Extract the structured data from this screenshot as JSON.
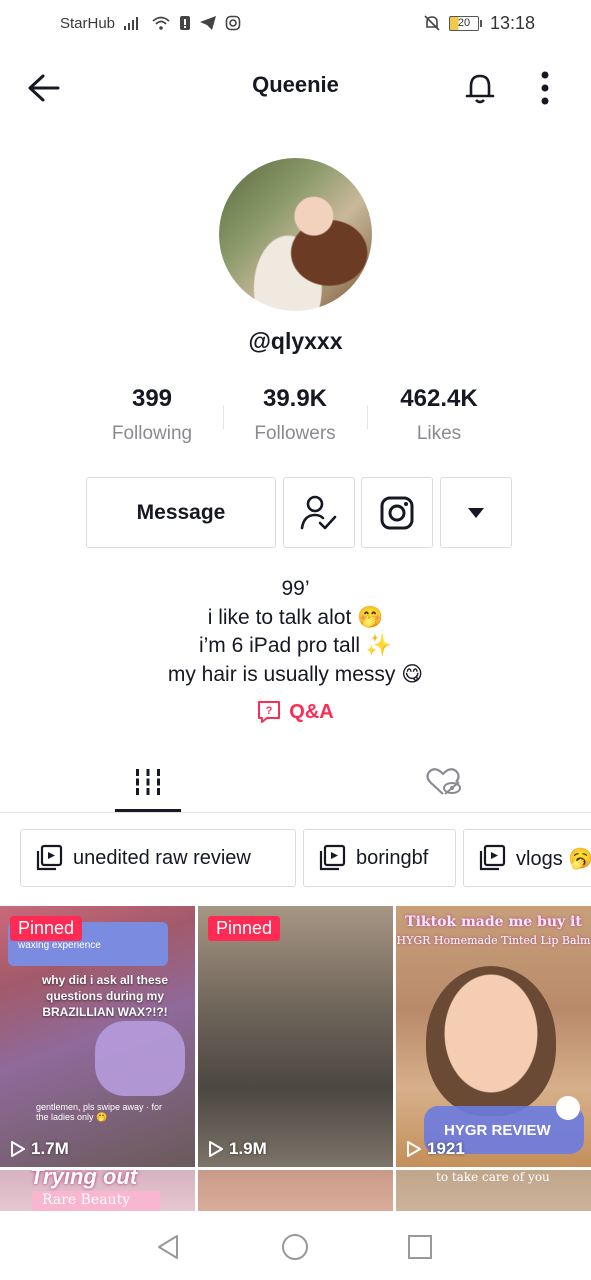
{
  "status_bar": {
    "carrier": "StarHub",
    "battery": "20",
    "time": "13:18"
  },
  "header": {
    "title": "Queenie"
  },
  "profile": {
    "username": "@qlyxxx",
    "stats": [
      {
        "value": "399",
        "label": "Following"
      },
      {
        "value": "39.9K",
        "label": "Followers"
      },
      {
        "value": "462.4K",
        "label": "Likes"
      }
    ],
    "message_label": "Message",
    "bio": [
      "99’",
      "i like to talk alot 🤭",
      "i’m 6 iPad pro tall ✨",
      "my hair is usually messy 😋"
    ],
    "qa_label": "Q&A"
  },
  "playlists": [
    {
      "label": "unedited raw review"
    },
    {
      "label": "boringbf"
    },
    {
      "label": "vlogs 🥱"
    }
  ],
  "videos": [
    {
      "pinned_label": "Pinned",
      "views": "1.7M",
      "card_text": "waxing experience",
      "caption": "why did i ask all these questions during my BRAZILLIAN WAX?!?!",
      "footer": "gentlemen, pls swipe away · for the ladies only 🤭"
    },
    {
      "pinned_label": "Pinned",
      "views": "1.9M"
    },
    {
      "views": "1921",
      "title": "Tiktok made me buy it",
      "subtitle": "HYGR Homemade Tinted Lip Balm",
      "badge": "HYGR REVIEW"
    },
    {
      "title": "Trying out",
      "subtitle": "Rare Beauty"
    },
    {},
    {
      "caption": "to take care of you"
    }
  ],
  "colors": {
    "accent": "#fe2c55",
    "text": "#161823",
    "muted": "#8a8b91",
    "border": "#dcdcde"
  }
}
